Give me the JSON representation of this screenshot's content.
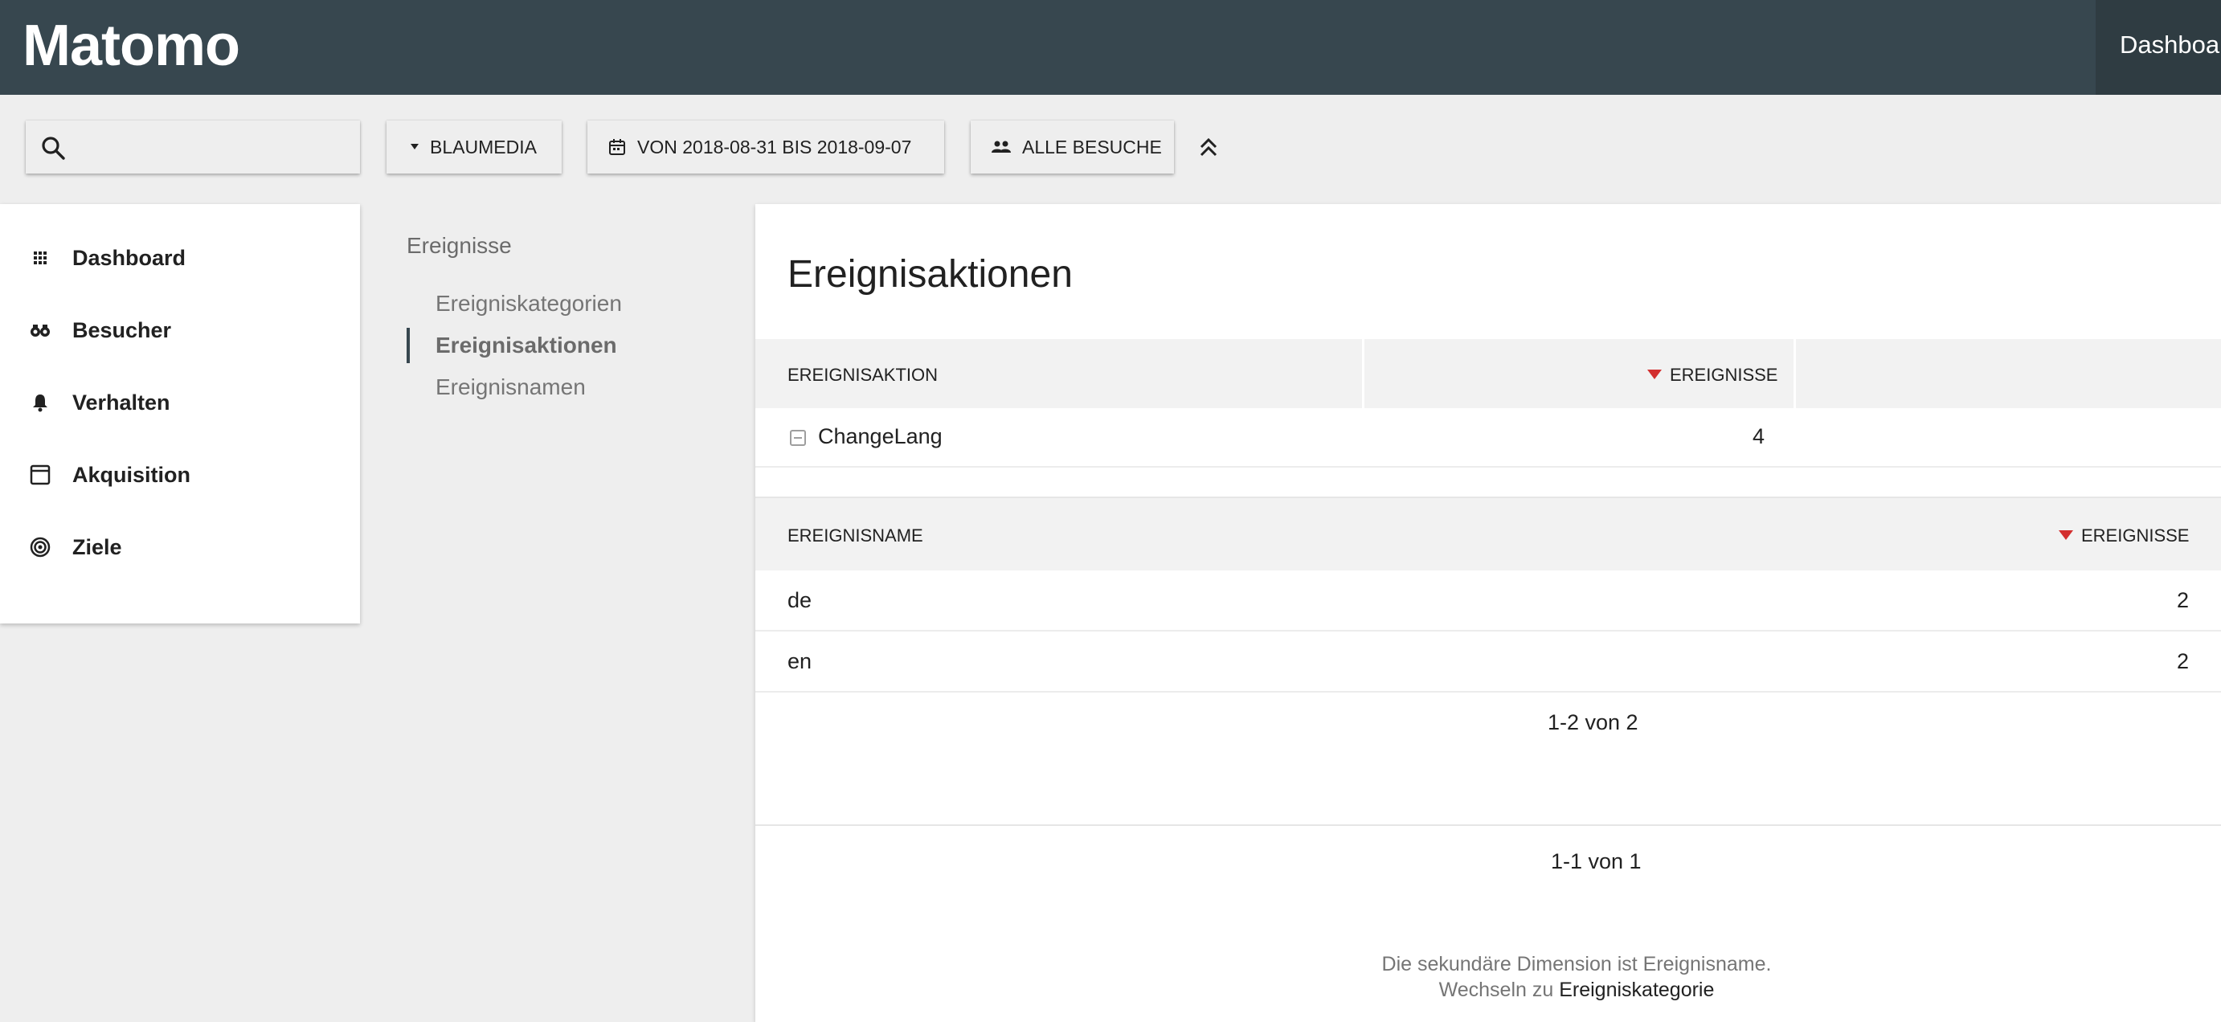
{
  "header": {
    "logo": "Matomo",
    "nav_item": "Dashboard"
  },
  "controls": {
    "search_placeholder": "",
    "site": "BLAUMEDIA",
    "date_range": "VON 2018-08-31 BIS 2018-09-07",
    "segment": "ALLE BESUCHE"
  },
  "menu": {
    "items": [
      {
        "label": "Dashboard",
        "icon": "grid-icon"
      },
      {
        "label": "Besucher",
        "icon": "binoculars-icon"
      },
      {
        "label": "Verhalten",
        "icon": "bell-icon"
      },
      {
        "label": "Akquisition",
        "icon": "window-icon"
      },
      {
        "label": "Ziele",
        "icon": "target-icon"
      }
    ]
  },
  "subnav": {
    "title": "Ereignisse",
    "items": [
      "Ereigniskategorien",
      "Ereignisaktionen",
      "Ereignisnamen"
    ],
    "active_index": 1
  },
  "report": {
    "title": "Ereignisaktionen",
    "table": {
      "columns": [
        "EREIGNISAKTION",
        "EREIGNISSE"
      ],
      "rows": [
        {
          "label": "ChangeLang",
          "value": "4"
        }
      ]
    },
    "subtable": {
      "columns": [
        "EREIGNISNAME",
        "EREIGNISSE"
      ],
      "rows": [
        {
          "label": "de",
          "value": "2"
        },
        {
          "label": "en",
          "value": "2"
        }
      ],
      "pagination": "1-2 von 2"
    },
    "pagination": "1-1 von 1",
    "secondary_dimension_note": "Die sekundäre Dimension ist Ereignisname.",
    "switch_prefix": "Wechseln zu",
    "switch_link": "Ereigniskategorie"
  },
  "colors": {
    "header_bg": "#37474f",
    "sort_arrow": "#d32f2f",
    "page_bg": "#eeeeee"
  }
}
